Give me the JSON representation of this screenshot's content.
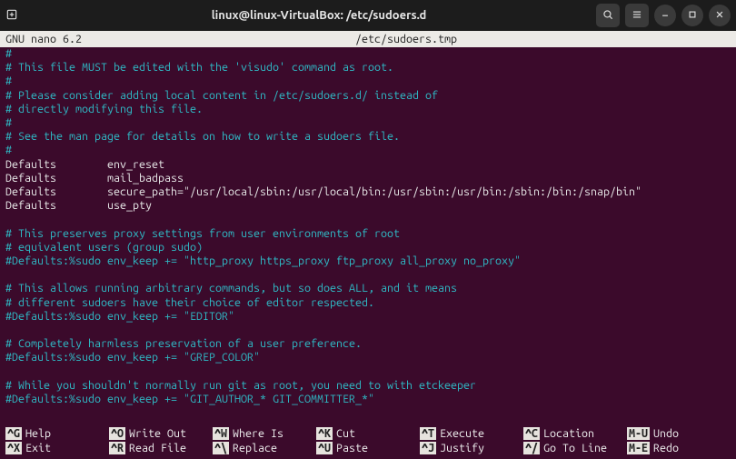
{
  "title": "linux@linux-VirtualBox: /etc/sudoers.d",
  "statusbar": {
    "left": "GNU nano 6.2",
    "center": "/etc/sudoers.tmp"
  },
  "lines": [
    {
      "cls": "comment",
      "text": "#"
    },
    {
      "cls": "comment",
      "text": "# This file MUST be edited with the 'visudo' command as root."
    },
    {
      "cls": "comment",
      "text": "#"
    },
    {
      "cls": "comment",
      "text": "# Please consider adding local content in /etc/sudoers.d/ instead of"
    },
    {
      "cls": "comment",
      "text": "# directly modifying this file."
    },
    {
      "cls": "comment",
      "text": "#"
    },
    {
      "cls": "comment",
      "text": "# See the man page for details on how to write a sudoers file."
    },
    {
      "cls": "comment",
      "text": "#"
    },
    {
      "cls": "plain",
      "text": "Defaults        env_reset"
    },
    {
      "cls": "plain",
      "text": "Defaults        mail_badpass"
    },
    {
      "cls": "plain",
      "text": "Defaults        secure_path=\"/usr/local/sbin:/usr/local/bin:/usr/sbin:/usr/bin:/sbin:/bin:/snap/bin\""
    },
    {
      "cls": "plain",
      "text": "Defaults        use_pty"
    },
    {
      "cls": "plain",
      "text": ""
    },
    {
      "cls": "comment",
      "text": "# This preserves proxy settings from user environments of root"
    },
    {
      "cls": "comment",
      "text": "# equivalent users (group sudo)"
    },
    {
      "cls": "comment",
      "text": "#Defaults:%sudo env_keep += \"http_proxy https_proxy ftp_proxy all_proxy no_proxy\""
    },
    {
      "cls": "plain",
      "text": ""
    },
    {
      "cls": "comment",
      "text": "# This allows running arbitrary commands, but so does ALL, and it means"
    },
    {
      "cls": "comment",
      "text": "# different sudoers have their choice of editor respected."
    },
    {
      "cls": "comment",
      "text": "#Defaults:%sudo env_keep += \"EDITOR\""
    },
    {
      "cls": "plain",
      "text": ""
    },
    {
      "cls": "comment",
      "text": "# Completely harmless preservation of a user preference."
    },
    {
      "cls": "comment",
      "text": "#Defaults:%sudo env_keep += \"GREP_COLOR\""
    },
    {
      "cls": "plain",
      "text": ""
    },
    {
      "cls": "comment",
      "text": "# While you shouldn't normally run git as root, you need to with etckeeper"
    },
    {
      "cls": "comment",
      "text": "#Defaults:%sudo env_keep += \"GIT_AUTHOR_* GIT_COMMITTER_*\""
    }
  ],
  "shortcuts": [
    {
      "key": "^G",
      "label": "Help"
    },
    {
      "key": "^O",
      "label": "Write Out"
    },
    {
      "key": "^W",
      "label": "Where Is"
    },
    {
      "key": "^K",
      "label": "Cut"
    },
    {
      "key": "^T",
      "label": "Execute"
    },
    {
      "key": "^C",
      "label": "Location"
    },
    {
      "key": "M-U",
      "label": "Undo"
    },
    {
      "key": "^X",
      "label": "Exit"
    },
    {
      "key": "^R",
      "label": "Read File"
    },
    {
      "key": "^\\",
      "label": "Replace"
    },
    {
      "key": "^U",
      "label": "Paste"
    },
    {
      "key": "^J",
      "label": "Justify"
    },
    {
      "key": "^/",
      "label": "Go To Line"
    },
    {
      "key": "M-E",
      "label": "Redo"
    }
  ]
}
